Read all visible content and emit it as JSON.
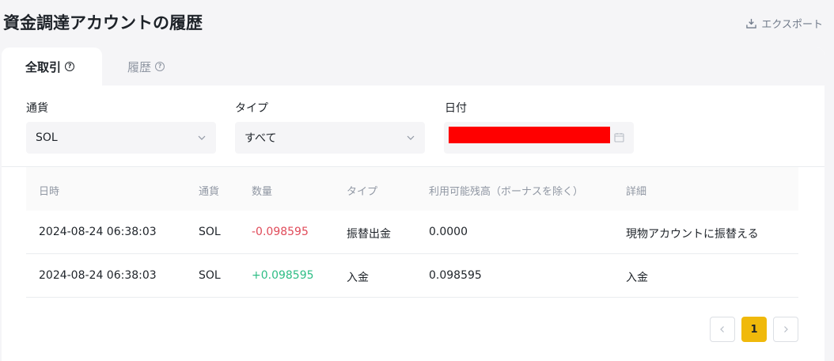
{
  "header": {
    "title": "資金調達アカウントの履歴",
    "export_label": "エクスポート"
  },
  "tabs": [
    {
      "label": "全取引",
      "active": true
    },
    {
      "label": "履歴",
      "active": false
    }
  ],
  "filters": {
    "currency": {
      "label": "通貨",
      "value": "SOL"
    },
    "type": {
      "label": "タイプ",
      "value": "すべて"
    },
    "date": {
      "label": "日付",
      "value": ""
    }
  },
  "table": {
    "columns": [
      "日時",
      "通貨",
      "数量",
      "タイプ",
      "利用可能残高（ボーナスを除く）",
      "詳細"
    ],
    "rows": [
      {
        "datetime": "2024-08-24 06:38:03",
        "currency": "SOL",
        "amount": "-0.098595",
        "type": "振替出金",
        "balance": "0.0000",
        "detail": "現物アカウントに振替える"
      },
      {
        "datetime": "2024-08-24 06:38:03",
        "currency": "SOL",
        "amount": "+0.098595",
        "type": "入金",
        "balance": "0.098595",
        "detail": "入金"
      }
    ]
  },
  "pagination": {
    "current_page": "1",
    "prev_icon": "chevron-left-icon",
    "next_icon": "chevron-right-icon"
  },
  "colors": {
    "accent": "#f0b90b",
    "negative": "#e04a59",
    "positive": "#2ebd85",
    "redaction": "#ff0000"
  }
}
